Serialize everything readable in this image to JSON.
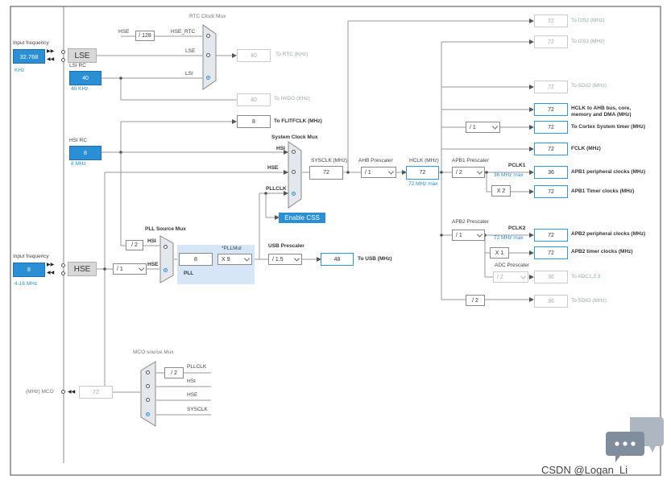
{
  "inputs": {
    "lse": {
      "label": "Input frequency",
      "value": "32.768",
      "unit": "KHz",
      "source": "LSE"
    },
    "hse": {
      "label": "Input frequency",
      "value": "8",
      "unit": "4-16 MHz",
      "source": "HSE"
    }
  },
  "lsi": {
    "label": "LSI RC",
    "value": "40",
    "unit": "40 KHz"
  },
  "hsi": {
    "label": "HSI RC",
    "value": "8",
    "unit": "8 MHz"
  },
  "rtc": {
    "mux_label": "RTC Clock Mux",
    "hse_in": "HSE",
    "div128": "/ 128",
    "hse_rtc": "HSE_RTC",
    "lse": "LSE",
    "lsi": "LSI",
    "out_value": "40",
    "out_label": "To RTC (KHz)"
  },
  "iwdg": {
    "value": "40",
    "label": "To IWDG (KHz)"
  },
  "flitf": {
    "value": "8",
    "label": "To FLITFCLK (MHz)"
  },
  "sysmux": {
    "label": "System Clock Mux",
    "hsi": "HSI",
    "hse": "HSE",
    "pllclk": "PLLCLK"
  },
  "sysclk": {
    "label": "SYSCLK (MHz)",
    "value": "72"
  },
  "ahb": {
    "label": "AHB Prescaler",
    "value": "/ 1"
  },
  "hclk": {
    "label": "HCLK (MHz)",
    "value": "72",
    "max": "72 MHz max"
  },
  "css_button": "Enable CSS",
  "pll": {
    "src_mux_label": "PLL Source Mux",
    "hsi": "HSI",
    "hse": "HSE",
    "div2": "/ 2",
    "hse_div": "/ 1",
    "value": "8",
    "label": "PLL",
    "mul_label": "*PLLMul",
    "mul": "X 9"
  },
  "usb": {
    "label": "USB Prescaler",
    "value": "/ 1.5",
    "out": "48",
    "out_label": "To USB (MHz)"
  },
  "i2s2": {
    "value": "72",
    "label": "To I2S2 (MHz)"
  },
  "i2s3": {
    "value": "72",
    "label": "To I2S3 (MHz)"
  },
  "sdio1": {
    "value": "72",
    "label": "To SDIO (MHz)"
  },
  "hclk_ahb": {
    "value": "72",
    "label": "HCLK to AHB bus, core, memory and DMA (MHz)"
  },
  "cortex": {
    "div": "/ 1",
    "value": "72",
    "label": "To Cortex System timer (MHz)"
  },
  "fclk": {
    "value": "72",
    "label": "FCLK (MHz)"
  },
  "apb1": {
    "label": "APB1 Prescaler",
    "value": "/ 2",
    "pclk": "PCLK1",
    "max": "36 MHz max",
    "periph": "36",
    "periph_label": "APB1 peripheral clocks (MHz)",
    "timer_mul": "X 2",
    "timer": "72",
    "timer_label": "APB1 Timer clocks (MHz)"
  },
  "apb2": {
    "label": "APB2 Prescaler",
    "value": "/ 1",
    "pclk": "PCLK2",
    "max": "72 MHz max",
    "periph": "72",
    "periph_label": "APB2 peripheral clocks (MHz)",
    "timer_mul": "X 1",
    "timer": "72",
    "timer_label": "APB2 timer clocks (MHz)"
  },
  "adc": {
    "label": "ADC Prescaler",
    "value": "/ 2",
    "out": "36",
    "out_label": "To ADC1,2,3"
  },
  "sdio2": {
    "div": "/ 2",
    "value": "36",
    "label": "To SDIO (MHz)"
  },
  "mco": {
    "mux_label": "MCO source Mux",
    "out_label": "(MHz) MCO",
    "value": "72",
    "div2": "/ 2",
    "pllclk": "PLLCLK",
    "hsi": "HSI",
    "hse": "HSE",
    "sysclk": "SYSCLK"
  },
  "watermark": "CSDN @Logan_Li"
}
